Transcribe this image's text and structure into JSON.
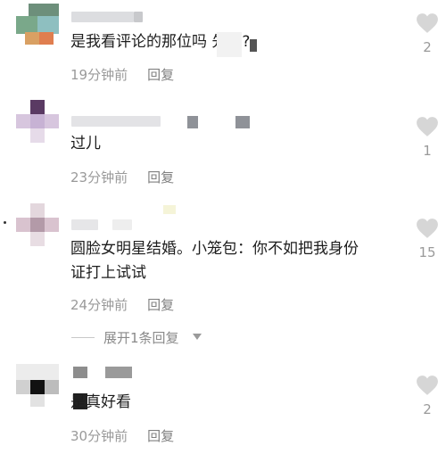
{
  "comments": [
    {
      "text": "是我看评论的那位吗    先生?",
      "time": "19分钟前",
      "reply": "回复",
      "likes": "2"
    },
    {
      "text": "过儿",
      "time": "23分钟前",
      "reply": "回复",
      "likes": "1"
    },
    {
      "text_line1": "圆脸女明星结婚。小笼包：你不如把我身份",
      "text_line2": "证打上试试",
      "time": "24分钟前",
      "reply": "回复",
      "likes": "15",
      "expand_label": "展开1条回复"
    },
    {
      "text": "  是真好看",
      "time": "30分钟前",
      "reply": "回复",
      "likes": "2"
    }
  ],
  "icons": {
    "like": "heart-outline-icon",
    "expand": "caret-down-icon"
  },
  "colors": {
    "text": "#1d1d1d",
    "meta": "#9a9a9a",
    "heart": "#cfcfcf"
  }
}
